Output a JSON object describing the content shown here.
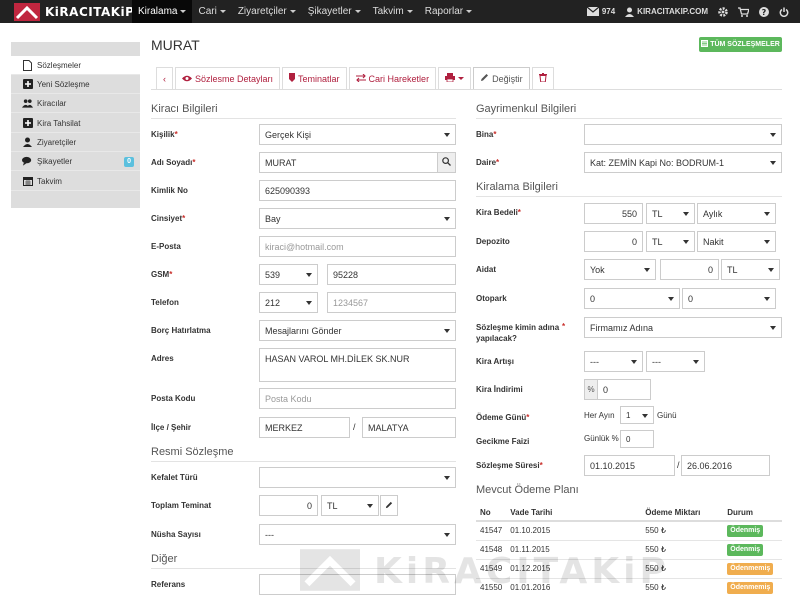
{
  "navbar": {
    "brand": "KiRACITAKiP",
    "menu": [
      {
        "label": "Kiralama",
        "active": true
      },
      {
        "label": "Cari",
        "active": false
      },
      {
        "label": "Ziyaretçiler",
        "active": false
      },
      {
        "label": "Şikayetler",
        "active": false
      },
      {
        "label": "Takvim",
        "active": false
      },
      {
        "label": "Raporlar",
        "active": false
      }
    ],
    "mail_count": "974",
    "site": "KIRACITAKIP.COM",
    "colors": {
      "bar": "#222222",
      "accent": "#b0203f"
    }
  },
  "sidebar": {
    "items": [
      {
        "label": "Sözleşmeler",
        "icon": "document-icon",
        "active": true
      },
      {
        "label": "Yeni Sözleşme",
        "icon": "plus-square-icon"
      },
      {
        "label": "Kiracılar",
        "icon": "users-icon"
      },
      {
        "label": "Kira Tahsilat",
        "icon": "plus-square-icon"
      },
      {
        "label": "Ziyaretçiler",
        "icon": "user-icon"
      },
      {
        "label": "Şikayetler",
        "icon": "comments-icon",
        "badge": "0"
      },
      {
        "label": "Takvim",
        "icon": "calendar-icon"
      }
    ]
  },
  "page": {
    "title": "MURAT",
    "all_contracts_button": "TÜM SÖZLEŞMELER",
    "tabs": [
      {
        "label": "‹",
        "icon": ""
      },
      {
        "label": "Sözlesme Detayları",
        "icon": "eye-icon"
      },
      {
        "label": "Teminatlar",
        "icon": "tag-icon"
      },
      {
        "label": "Cari Hareketler",
        "icon": "exchange-icon"
      },
      {
        "label": "",
        "icon": "print-icon"
      },
      {
        "label": "Değiştir",
        "icon": "pencil-icon",
        "active": true
      },
      {
        "label": "",
        "icon": "trash-icon"
      }
    ]
  },
  "tenant": {
    "section_title": "Kiracı Bilgileri",
    "kisilik_label": "Kişilik",
    "kisilik_value": "Gerçek Kişi",
    "name_label": "Adı Soyadı",
    "name_value": "MURAT",
    "tc_label": "Kimlik No",
    "tc_value": "625090393",
    "gender_label": "Cinsiyet",
    "gender_value": "Bay",
    "email_label": "E-Posta",
    "email_placeholder": "kiraci@hotmail.com",
    "gsm_label": "GSM",
    "gsm_code": "539",
    "gsm_number": "95228",
    "phone_label": "Telefon",
    "phone_code": "212",
    "phone_placeholder": "1234567",
    "reminder_label": "Borç Hatırlatma",
    "reminder_value": "Mesajlarını Gönder",
    "address_label": "Adres",
    "address_value": "HASAN VAROL MH.DİLEK SK.NUR",
    "postal_label": "Posta Kodu",
    "postal_placeholder": "Posta Kodu",
    "district_label": "İlçe / Şehir",
    "district_value": "MERKEZ",
    "city_sep": "/",
    "city_value": "MALATYA"
  },
  "official": {
    "section_title": "Resmi Sözleşme",
    "guarantee_type_label": "Kefalet Türü",
    "total_deposit_label": "Toplam Teminat",
    "total_deposit_value": "0",
    "total_deposit_currency": "TL",
    "copies_label": "Nüsha Sayısı",
    "copies_value": "---"
  },
  "other": {
    "section_title": "Diğer",
    "reference_label": "Referans"
  },
  "property": {
    "section_title": "Gayrimenkul Bilgileri",
    "building_label": "Bina",
    "unit_label": "Daire",
    "unit_value": "Kat: ZEMİN Kapi No: BODRUM-1"
  },
  "rental": {
    "section_title": "Kiralama Bilgileri",
    "rent_label": "Kira Bedeli",
    "rent_value": "550",
    "rent_currency": "TL",
    "rent_period": "Aylık",
    "deposit_label": "Depozito",
    "deposit_value": "0",
    "deposit_currency": "TL",
    "deposit_type": "Nakit",
    "dues_label": "Aidat",
    "dues_type": "Yok",
    "dues_value": "0",
    "dues_currency": "TL",
    "parking_label": "Otopark",
    "parking_a": "0",
    "parking_b": "0",
    "owner_label": "Sözleşme kimin adına yapılacak?",
    "owner_value": "Firmamız Adına",
    "increase_label": "Kira Artışı",
    "increase_a": "---",
    "increase_b": "---",
    "discount_label": "Kira İndirimi",
    "discount_prefix": "%",
    "discount_value": "0",
    "payday_label": "Ödeme Günü",
    "payday_prefix": "Her Ayın",
    "payday_value": "1",
    "payday_suffix": "Günü",
    "late_fee_label": "Gecikme Faizi",
    "late_fee_prefix": "Günlük %",
    "late_fee_value": "0",
    "term_label": "Sözleşme Süresi",
    "term_start": "01.10.2015",
    "term_sep": "/",
    "term_end": "26.06.2016"
  },
  "payments": {
    "section_title": "Mevcut Ödeme Planı",
    "columns": [
      "No",
      "Vade Tarihi",
      "Ödeme Miktarı",
      "Durum"
    ],
    "rows": [
      {
        "no": "41547",
        "date": "01.10.2015",
        "amount": "550 ₺",
        "status": "Ödenmiş",
        "paid": true
      },
      {
        "no": "41548",
        "date": "01.11.2015",
        "amount": "550 ₺",
        "status": "Ödenmiş",
        "paid": true
      },
      {
        "no": "41549",
        "date": "01.12.2015",
        "amount": "550 ₺",
        "status": "Ödenmemiş",
        "paid": false
      },
      {
        "no": "41550",
        "date": "01.01.2016",
        "amount": "550 ₺",
        "status": "Ödenmemiş",
        "paid": false
      }
    ]
  },
  "watermark": {
    "text": "KiRACITAKiP"
  }
}
